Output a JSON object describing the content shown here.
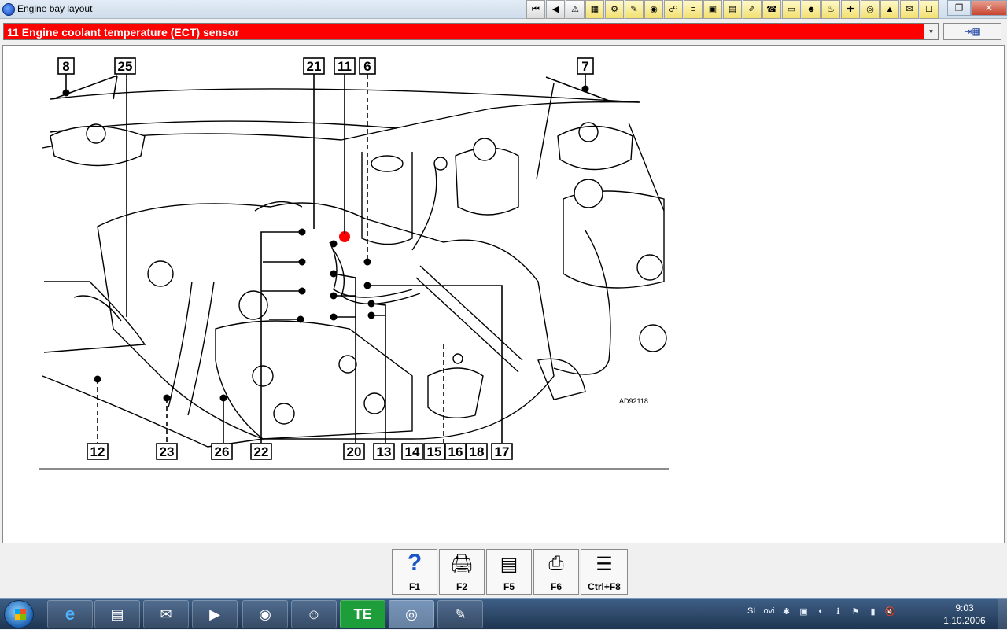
{
  "window": {
    "title": "Engine bay layout"
  },
  "toolbar": {
    "buttons": [
      {
        "name": "first",
        "glyph": "⏮"
      },
      {
        "name": "previous",
        "glyph": "◀"
      },
      {
        "name": "warning",
        "glyph": "⚠"
      },
      {
        "name": "tool-1",
        "glyph": "▦"
      },
      {
        "name": "tool-2",
        "glyph": "⚙"
      },
      {
        "name": "tool-3",
        "glyph": "✎"
      },
      {
        "name": "tool-4",
        "glyph": "◉"
      },
      {
        "name": "tool-5",
        "glyph": "☍"
      },
      {
        "name": "tool-6",
        "glyph": "≡"
      },
      {
        "name": "tool-7",
        "glyph": "▣"
      },
      {
        "name": "tool-8",
        "glyph": "▤"
      },
      {
        "name": "tool-9",
        "glyph": "✐"
      },
      {
        "name": "tool-10",
        "glyph": "☎"
      },
      {
        "name": "tool-11",
        "glyph": "▭"
      },
      {
        "name": "tool-12",
        "glyph": "☻"
      },
      {
        "name": "tool-13",
        "glyph": "♨"
      },
      {
        "name": "tool-14",
        "glyph": "✚"
      },
      {
        "name": "tool-15",
        "glyph": "◎"
      },
      {
        "name": "tool-16",
        "glyph": "▲"
      },
      {
        "name": "tool-17",
        "glyph": "✉"
      },
      {
        "name": "tool-18",
        "glyph": "☐"
      }
    ]
  },
  "selector": {
    "value": "11  Engine coolant temperature (ECT) sensor",
    "dropdown_glyph": "▾"
  },
  "nav_button": {
    "glyph": "⇥▦"
  },
  "diagram": {
    "code": "AD92118",
    "labels_top": [
      "8",
      "25",
      "21",
      "11",
      "6",
      "7"
    ],
    "labels_bottom": [
      "12",
      "23",
      "26",
      "22",
      "20",
      "13",
      "14",
      "15",
      "16",
      "18",
      "17"
    ],
    "highlight_color": "#ff0000"
  },
  "fkeys": [
    {
      "label": "F1",
      "icon": "?",
      "name": "help"
    },
    {
      "label": "F2",
      "icon": "🖨",
      "name": "print-preview"
    },
    {
      "label": "F5",
      "icon": "▤",
      "name": "document"
    },
    {
      "label": "F6",
      "icon": "⎙",
      "name": "print"
    },
    {
      "label": "Ctrl+F8",
      "icon": "☰",
      "name": "list"
    }
  ],
  "taskbar": {
    "apps": [
      {
        "name": "internet-explorer",
        "glyph": "e"
      },
      {
        "name": "file-explorer",
        "glyph": "▤"
      },
      {
        "name": "outlook",
        "glyph": "✉"
      },
      {
        "name": "media-player",
        "glyph": "▶"
      },
      {
        "name": "chrome",
        "glyph": "◉"
      },
      {
        "name": "messenger",
        "glyph": "☺"
      },
      {
        "name": "te-app",
        "glyph": "TE"
      },
      {
        "name": "autodata",
        "glyph": "◎"
      },
      {
        "name": "paint",
        "glyph": "✎"
      }
    ],
    "language": "SL",
    "time": "9:03",
    "date": "1.10.2006"
  }
}
